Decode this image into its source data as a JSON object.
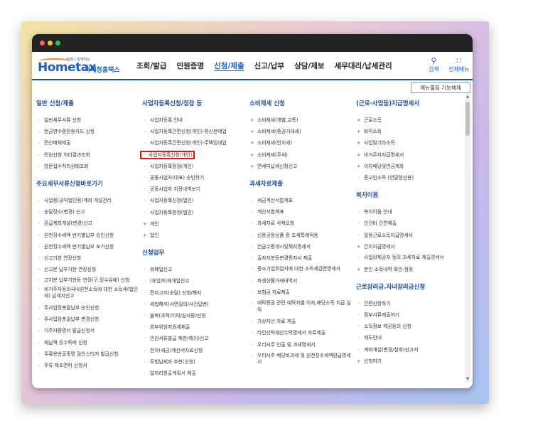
{
  "logo": {
    "word": "Hometax",
    "small": "언제나 함께하는",
    "agency": "국세청홈택스"
  },
  "nav": [
    {
      "label": "조회/발급"
    },
    {
      "label": "민원증명"
    },
    {
      "label": "신청/제출"
    },
    {
      "label": "신고/납부"
    },
    {
      "label": "상담/제보"
    },
    {
      "label": "세무대리/납세관리"
    }
  ],
  "top_icons": {
    "search_label": "검색",
    "menu_label": "전체메뉴"
  },
  "collapse_button": "메뉴펼침 기능해제",
  "columns": [
    {
      "sections": [
        {
          "title": "일반 신청/제출",
          "items": [
            "일반세무서류 신청",
            "현금영수증전용카드 신청",
            "전산매체제출",
            "민원신청 처리결과조회",
            "방문접수처리상태조회"
          ]
        },
        {
          "title": "주요세무서류신청바로가기",
          "items": [
            "사업용(공익법인용)계좌 개설관리",
            "송달장소(변경) 신고",
            "환급계좌개설(변경)신고",
            "원천징수세액 반기별납부 승인신청",
            "원천징수세액 반기별납부 포기신청",
            "신고기한 연장신청",
            "신고분 납부기한 연장신청",
            "고지분 납부기한등 연장(구.징수유예) 신청",
            "비거주자등의국내원천소득에 대한 소득세(법인세) 납세지신고",
            "주사업장총괄납부 승인신청",
            "주사업장총괄납부 변경신청",
            "거주자증명서 발급신청서",
            "체납액 징수특례 신청",
            "주류용반출증명 검인스티커 발급신청",
            "주류 제조면허 신청서"
          ]
        }
      ]
    },
    {
      "sections": [
        {
          "title": "사업자등록신청/정정 등",
          "items": [
            "사업자등록 안내",
            "사업자등록간편신청(개인)-통신판매업",
            "사업자등록간편신청(개인)-주택임대업",
            "사업자등록신청(개인)",
            "사업자등록정정(개인)",
            "공동사업자(대표) 승인하기",
            "공동사업자 지정내역보기",
            "사업자등록신청(법인)",
            "사업자등록정정(법인)",
            "개인",
            "법인"
          ]
        },
        {
          "title": "신청업무",
          "items": [
            "휴폐업신고",
            "(휴업자)재개업신고",
            "전자고지(송달) 신청/해지",
            "세법해석(서면질의/사전답변)",
            "불복(과적/이의/심사등)신청",
            "외부위원지원세제출",
            "민원서류발급 제한(해지)신고",
            "전자(세금)계산서자료신청",
            "모범납세자 추천(신청)",
            "일자리창출계획서 제출"
          ]
        }
      ]
    },
    {
      "sections": [
        {
          "title": "소비제세 신청",
          "items": [
            "소비제세(개별,교통)",
            "소비제세(증권거래세)",
            "소비제세(인지세)",
            "소비제세(주세)",
            "면세미납세신청신고"
          ]
        },
        {
          "title": "과세자료제출",
          "items": [
            "세금계산서합계표",
            "계산서합계표",
            "과세자료 삭제요청",
            "신용공용상품 중 조세특례적용",
            "연금수령개시및해지명세서",
            "출자지분등변경통지서 제출",
            "중소기업취업자에 대한 소득세감면명세서",
            "파생상품거래내역서",
            "보험금 자료제출",
            "예탁증권 관련 예탁자별 이자,배당소득 지급 실적",
            "가상자산 자료 제출",
            "타인신탁재산수탁명세서 자료제출",
            "우리사주 인출 및 과세명세서",
            "우리사주 배당비과세 및 원천징수세액환급명세서"
          ]
        }
      ]
    },
    {
      "sections": [
        {
          "title": "(근로·사업등)지급명세서",
          "items": [
            "근로소득",
            "퇴직소득",
            "사업및기타소득",
            "비거주자지급명세서",
            "이자배당및연금계좌",
            "종교인소득 (연말정산용)"
          ]
        },
        {
          "title": "복지이음",
          "items": [
            "복지이음 안내",
            "인건비 간편제출",
            "일용근로소득지급명세서",
            "간이지급명세서",
            "사업장제공자 등의 과세자료 제출명세서",
            "본인 소득내역 확인·정정"
          ]
        },
        {
          "title": "근로장려금.자녀장려금신청",
          "items": [
            "간편신청하기",
            "정부서류제출하기",
            "소득정보 제공동의 신청",
            "제도안내",
            "계좌개설(변경/철회)신고서",
            "신청하기"
          ]
        }
      ]
    }
  ]
}
